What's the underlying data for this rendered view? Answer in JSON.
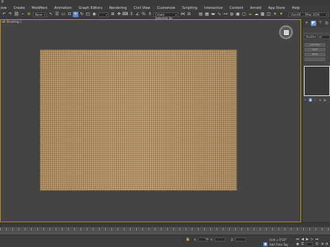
{
  "window": {
    "title_fragment": "0"
  },
  "menu": [
    {
      "label": "iew"
    },
    {
      "label": "Create"
    },
    {
      "label": "Modifiers"
    },
    {
      "label": "Animation"
    },
    {
      "label": "Graph Editors"
    },
    {
      "label": "Rendering"
    },
    {
      "label": "Civil View"
    },
    {
      "label": "Customize"
    },
    {
      "label": "Scripting"
    },
    {
      "label": "Interactive"
    },
    {
      "label": "Content"
    },
    {
      "label": "Arnold"
    },
    {
      "label": "App Store"
    },
    {
      "label": "Help"
    }
  ],
  "toolbar": {
    "selection_filter": "None",
    "named_selection": "Create Selection Se",
    "workspace": "User48 ... [Max 2016"
  },
  "viewport": {
    "label": "ult Shading ]"
  },
  "command_panel": {
    "modifier_list": "Modifier List",
    "buttons": [
      "Edit Poly",
      "Shell",
      "Bend"
    ]
  },
  "status": {
    "grid": "Grid = 0'10\"",
    "add_time_tag": "Add Time Tag",
    "x_label": "X:",
    "y_label": "Y:",
    "z_label": "Z:"
  },
  "colors": {
    "accent_blue": "#5b86c6",
    "viewport_border": "#b59227",
    "fabric": "#b89368"
  }
}
